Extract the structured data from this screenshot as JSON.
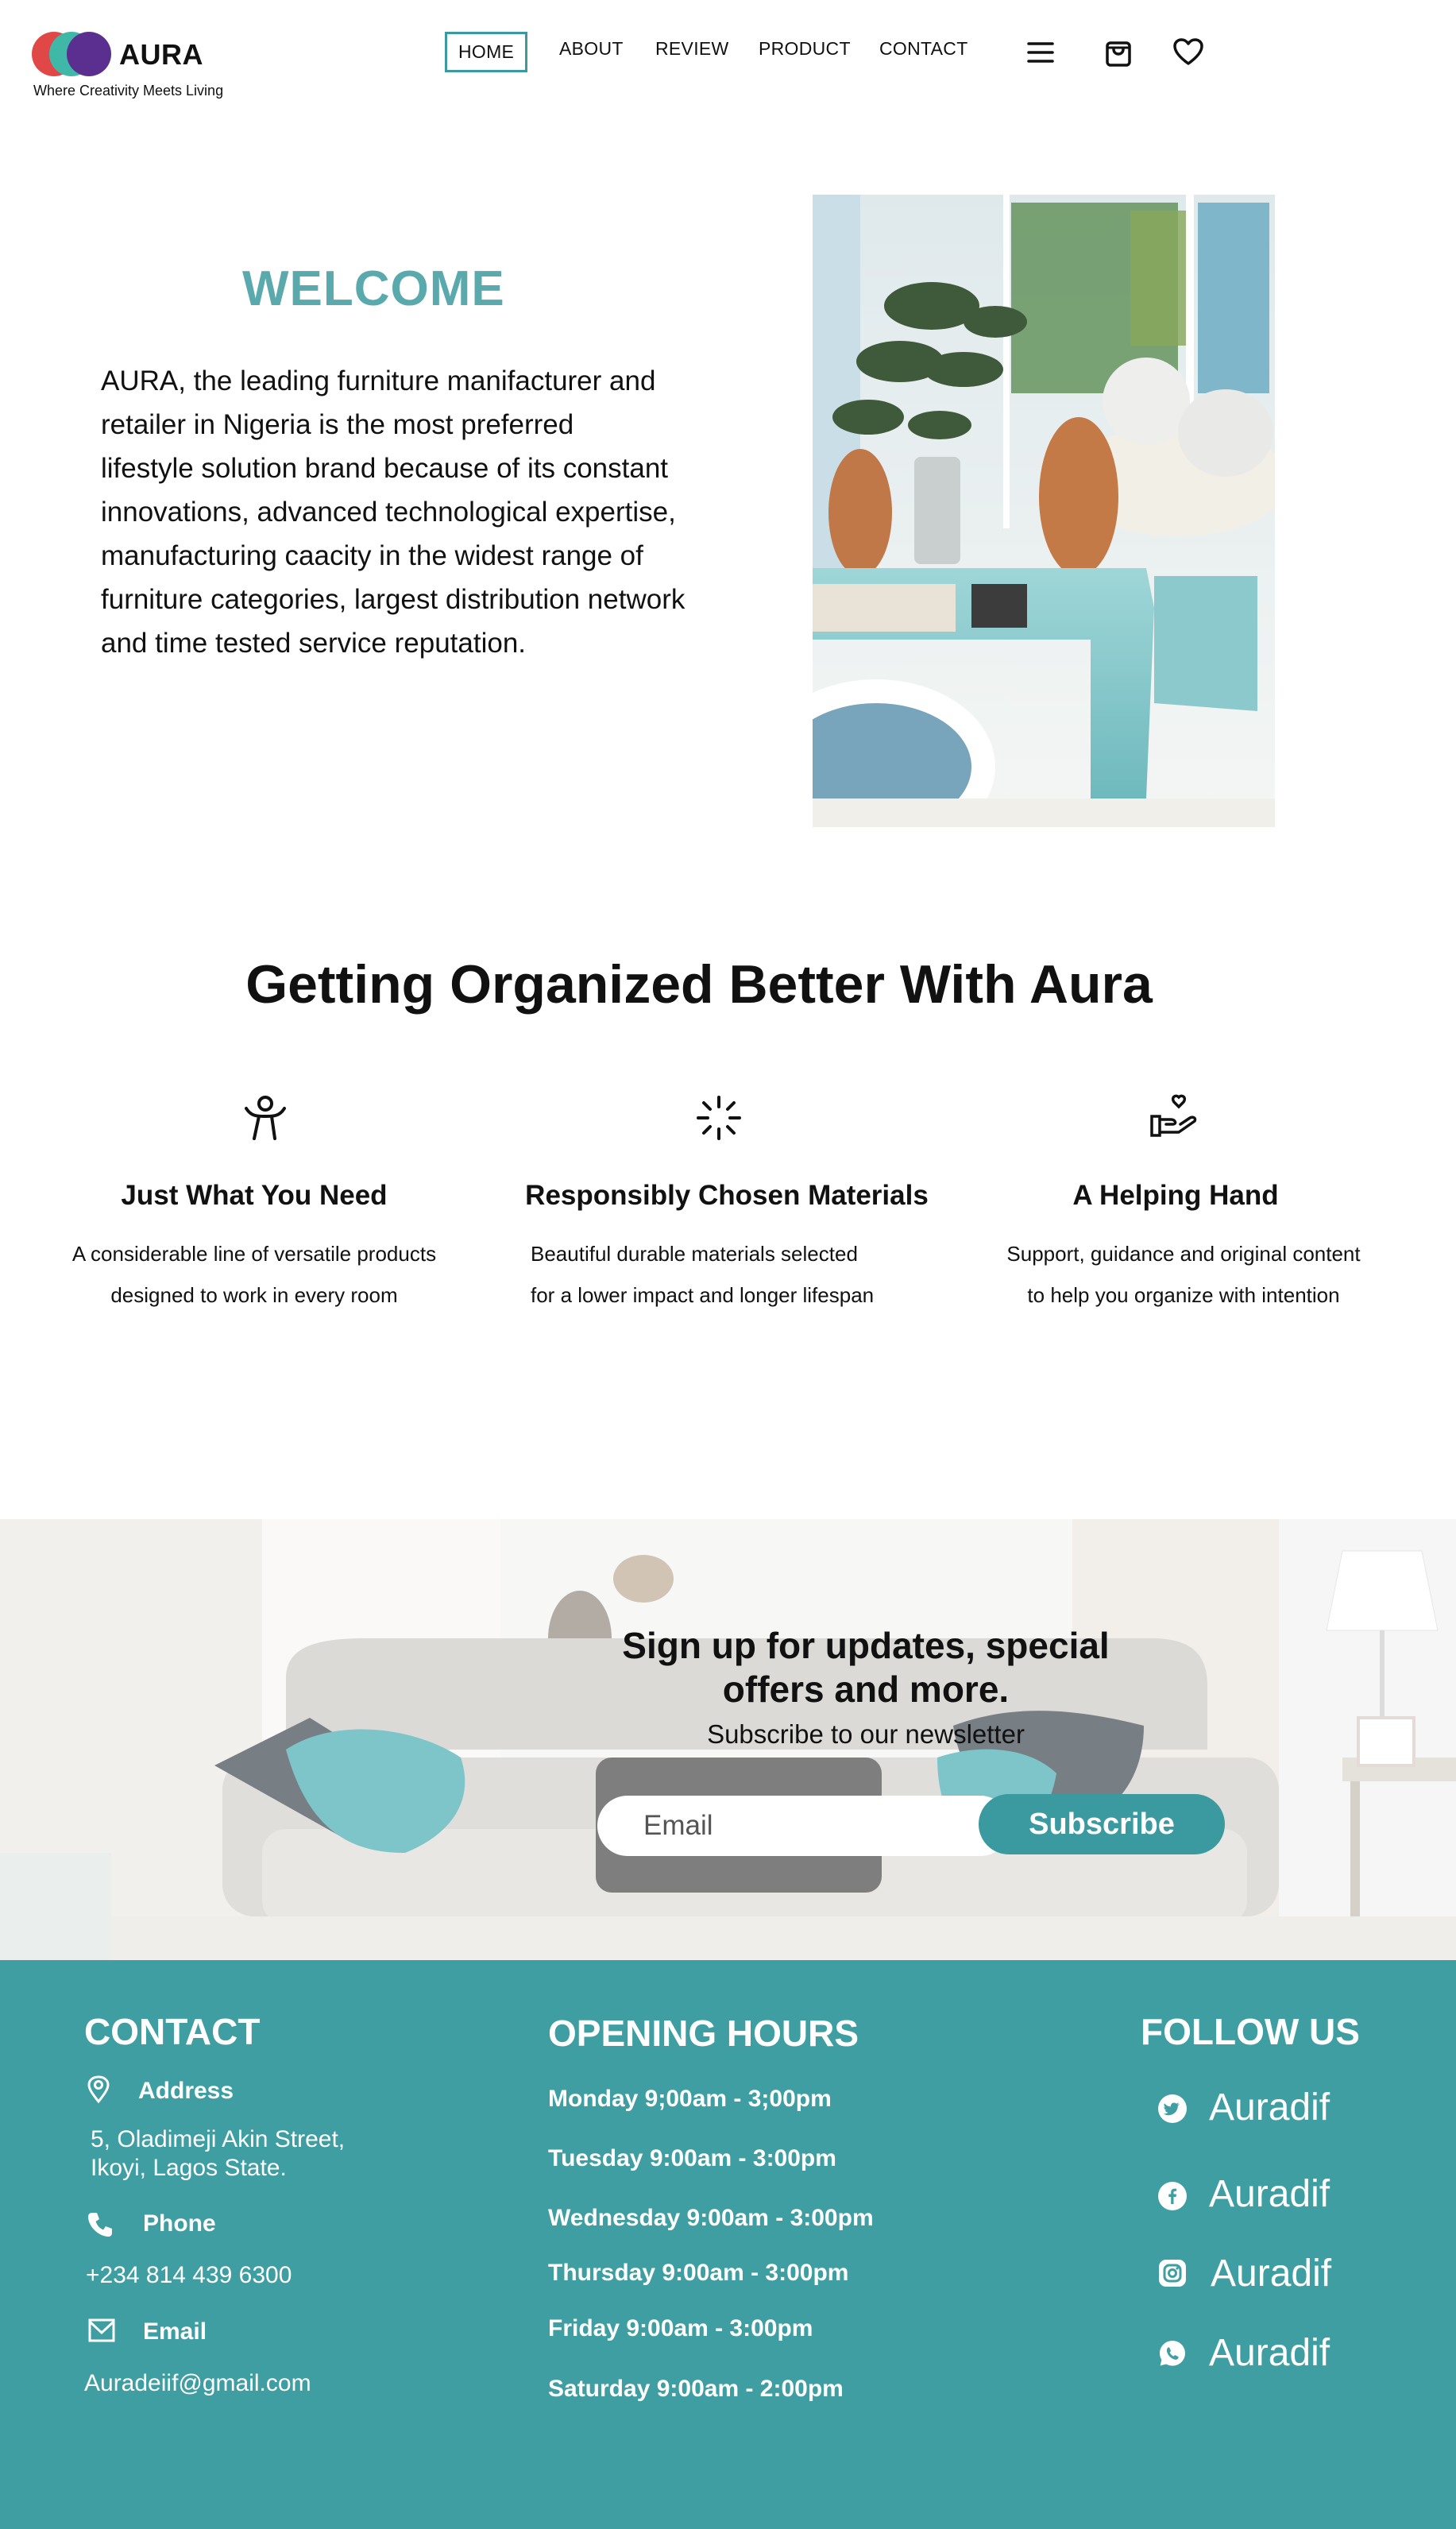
{
  "brand": {
    "name": "AURA",
    "tagline": "Where Creativity Meets Living",
    "colors": {
      "red": "#e04848",
      "teal": "#3fb8a8",
      "purple": "#5b2f8f",
      "accent": "#3f9ea2",
      "heading_teal": "#5aa9ad"
    }
  },
  "nav": {
    "items": [
      {
        "label": "HOME",
        "active": true
      },
      {
        "label": "ABOUT"
      },
      {
        "label": "REVIEW"
      },
      {
        "label": "PRODUCT"
      },
      {
        "label": "CONTACT"
      }
    ],
    "icons": [
      "menu-icon",
      "shopping-bag-icon",
      "heart-icon"
    ]
  },
  "welcome": {
    "title": "WELCOME",
    "lines": [
      "AURA, the leading furniture manifacturer and",
      "retailer in Nigeria is the most preferred",
      "lifestyle solution brand because of its constant",
      "innovations, advanced technological expertise,",
      "manufacturing caacity in the widest range of",
      "furniture categories, largest distribution network",
      "and time tested service reputation."
    ]
  },
  "features": {
    "title": "Getting Organized Better With Aura",
    "items": [
      {
        "icon": "person-icon",
        "title": "Just What You Need",
        "lines": [
          "A considerable line of versatile products",
          "designed to work in every room"
        ]
      },
      {
        "icon": "loader-icon",
        "title": "Responsibly Chosen Materials",
        "lines": [
          "Beautiful durable materials selected",
          "for a lower impact and longer lifespan"
        ]
      },
      {
        "icon": "hand-heart-icon",
        "title": "A Helping Hand",
        "lines": [
          "Support, guidance and original content",
          "to help you organize with intention"
        ]
      }
    ]
  },
  "newsletter": {
    "title_line1": "Sign up for updates, special",
    "title_line2": "offers and more.",
    "subtitle": "Subscribe to our newsletter",
    "email_placeholder": "Email",
    "button": "Subscribe"
  },
  "footer": {
    "contact": {
      "heading": "CONTACT",
      "address_label": "Address",
      "address_line1": "5, Oladimeji Akin Street,",
      "address_line2": "Ikoyi, Lagos State.",
      "phone_label": "Phone",
      "phone": "+234 814 439 6300",
      "email_label": "Email",
      "email": "Auradeiif@gmail.com"
    },
    "hours": {
      "heading": "OPENING HOURS",
      "rows": [
        "Monday  9;00am - 3;00pm",
        "Tuesday 9:00am  - 3:00pm",
        "Wednesday 9:00am - 3:00pm",
        "Thursday 9:00am - 3:00pm",
        "Friday 9:00am - 3:00pm",
        "Saturday 9:00am - 2:00pm"
      ]
    },
    "follow": {
      "heading": "FOLLOW US",
      "items": [
        {
          "icon": "twitter-icon",
          "handle": "Auradif"
        },
        {
          "icon": "facebook-icon",
          "handle": "Auradif"
        },
        {
          "icon": "instagram-icon",
          "handle": "Auradif"
        },
        {
          "icon": "whatsapp-icon",
          "handle": "Auradif"
        }
      ]
    }
  }
}
